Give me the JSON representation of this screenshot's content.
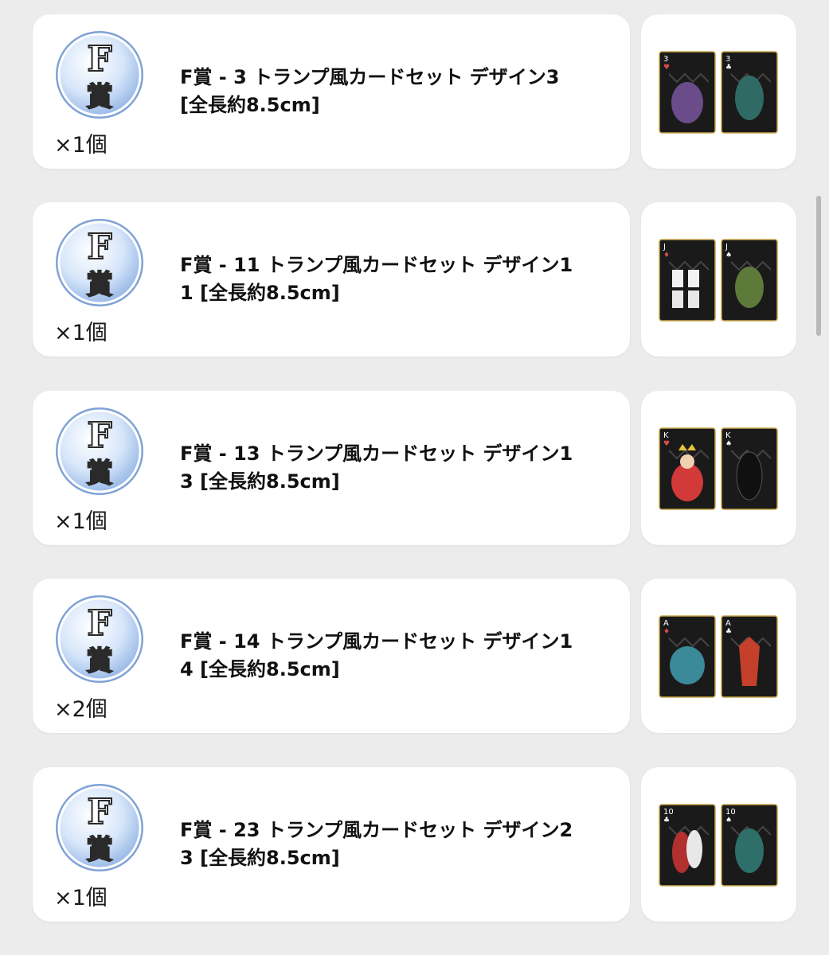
{
  "badge_letter": "F",
  "badge_kanji": "賞",
  "items": [
    {
      "title": "F賞 - 3 トランプ風カードセット デザイン3 [全長約8.5cm]",
      "quantity": "×1個",
      "rank": "3",
      "suit_a": "♥",
      "suit_b": "♣"
    },
    {
      "title": "F賞 - 11 トランプ風カードセット デザイン11 [全長約8.5cm]",
      "quantity": "×1個",
      "rank": "J",
      "suit_a": "♦",
      "suit_b": "♠"
    },
    {
      "title": "F賞 - 13 トランプ風カードセット デザイン13 [全長約8.5cm]",
      "quantity": "×1個",
      "rank": "K",
      "suit_a": "♥",
      "suit_b": "♠"
    },
    {
      "title": "F賞 - 14 トランプ風カードセット デザイン14 [全長約8.5cm]",
      "quantity": "×2個",
      "rank": "A",
      "suit_a": "♦",
      "suit_b": "♣"
    },
    {
      "title": "F賞 - 23 トランプ風カードセット デザイン23 [全長約8.5cm]",
      "quantity": "×1個",
      "rank": "10",
      "suit_a": "♣",
      "suit_b": "♠"
    }
  ],
  "colors": {
    "background": "#ececec",
    "card": "#ffffff",
    "badge_fill": "#cfe0f7",
    "badge_ring": "#8fb3e6",
    "card_face": "#1a1a1a",
    "card_border": "#c9a64a"
  }
}
